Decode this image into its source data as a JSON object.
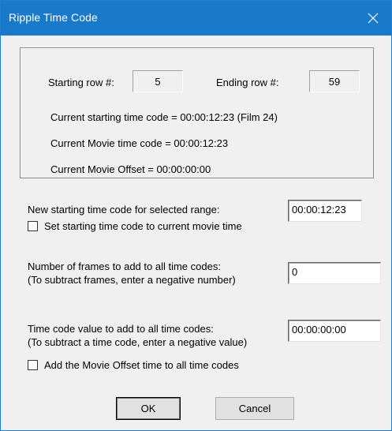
{
  "window": {
    "title": "Ripple Time Code",
    "close_glyph": "✕"
  },
  "info": {
    "starting_row_label": "Starting row #:",
    "starting_row_value": "5",
    "ending_row_label": "Ending row #:",
    "ending_row_value": "59",
    "current_starting_tc": "Current starting time code = 00:00:12:23 (Film 24)",
    "current_movie_tc": "Current Movie time code = 00:00:12:23",
    "current_movie_offset": "Current Movie Offset = 00:00:00:00"
  },
  "new_start": {
    "label": "New starting time code for selected range:",
    "value": "00:00:12:23",
    "checkbox_label": "Set starting time code to current movie time",
    "checkbox_checked": false
  },
  "frames": {
    "label_line1": "Number of frames to add to all time codes:",
    "label_line2": "(To subtract frames, enter a negative number)",
    "value": "0"
  },
  "tc_add": {
    "label_line1": "Time code value to add to all time codes:",
    "label_line2": "(To subtract a time code, enter a negative value)",
    "value": "00:00:00:00",
    "checkbox_label": "Add the Movie Offset time to all time codes",
    "checkbox_checked": false
  },
  "buttons": {
    "ok": "OK",
    "cancel": "Cancel"
  },
  "colors": {
    "titlebar": "#1979ca",
    "dialog_bg": "#f0f0f0"
  }
}
